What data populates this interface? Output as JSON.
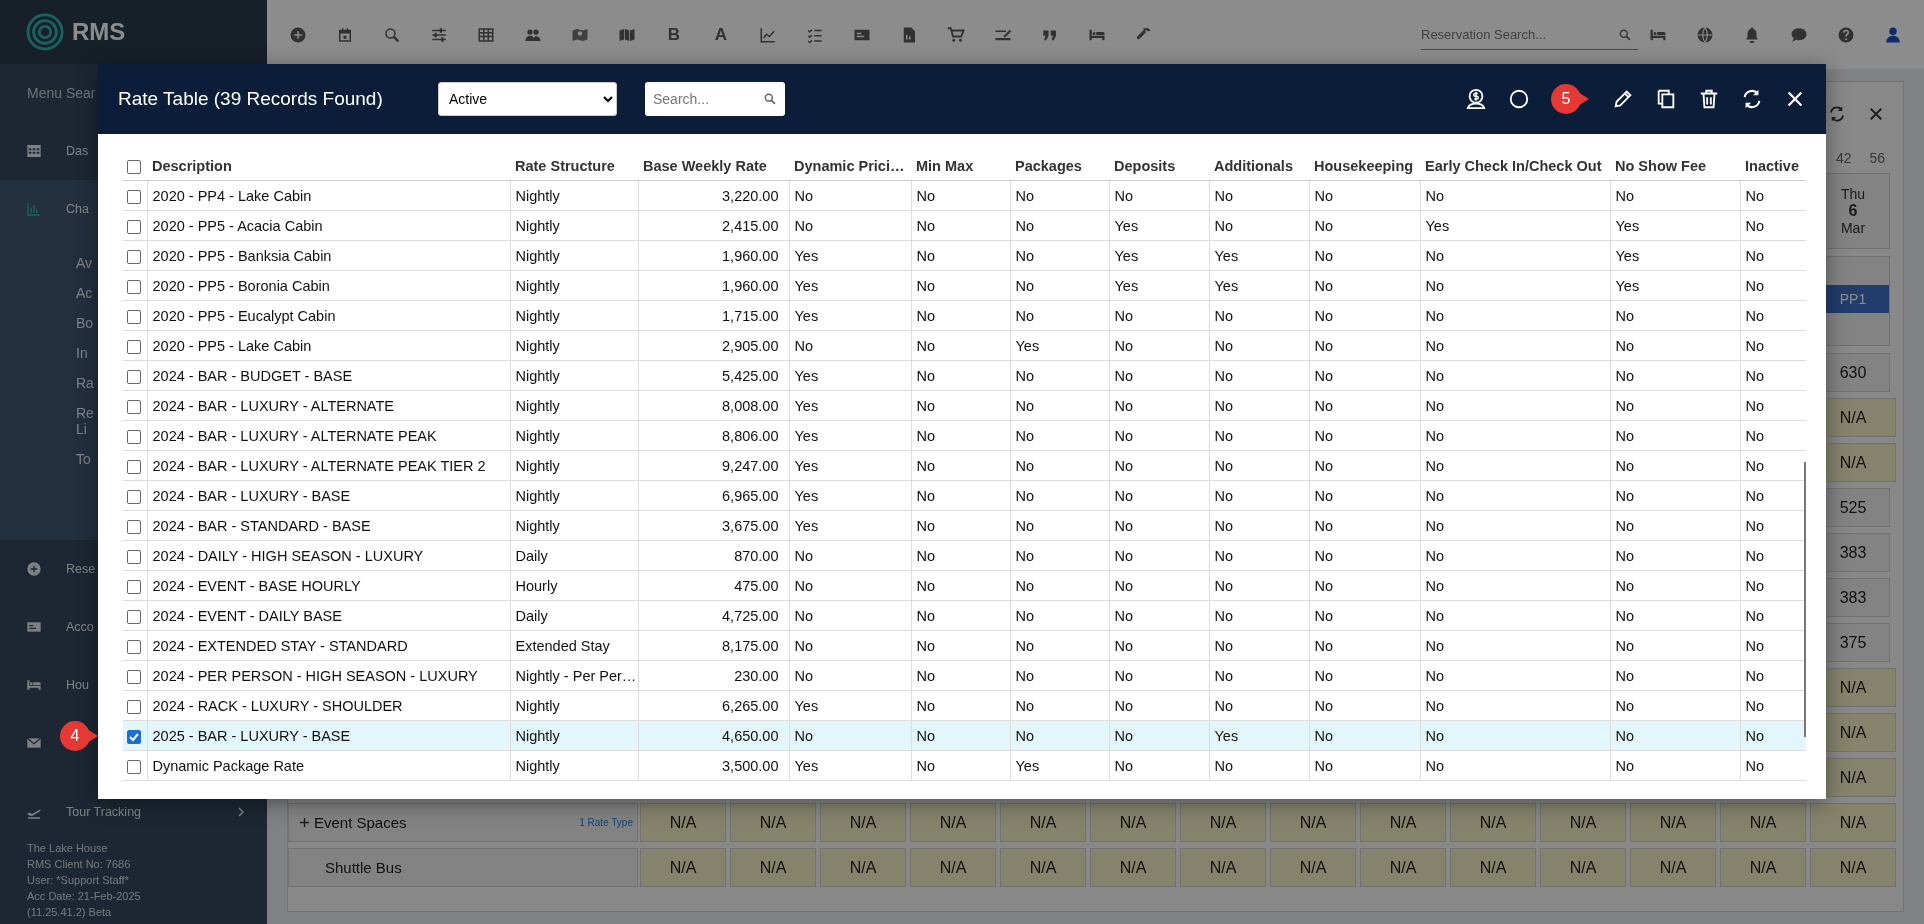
{
  "sidebar": {
    "brand": "RMS",
    "menu_search": "Menu Sear",
    "items": [
      {
        "label": "Das",
        "expanded": false,
        "has_submenu": false
      },
      {
        "label": "Cha",
        "expanded": true,
        "has_submenu": false,
        "children": [
          {
            "label": "Av"
          },
          {
            "label": "Ac"
          },
          {
            "label": "Bo"
          },
          {
            "label": "In"
          },
          {
            "label": "Ra"
          },
          {
            "label": "Re Li"
          },
          {
            "label": "To"
          }
        ]
      },
      {
        "label": "Rese",
        "expanded": false,
        "has_submenu": false
      },
      {
        "label": "Acco",
        "expanded": false,
        "has_submenu": false
      },
      {
        "label": "Hou",
        "expanded": false,
        "has_submenu": false
      },
      {
        "expanded": false,
        "has_submenu": false
      },
      {
        "label": "Tour Tracking",
        "expanded": false,
        "has_submenu": true
      }
    ],
    "footer": [
      "The Lake House",
      "RMS Client No: 7686",
      "User: *Support Staff*",
      "Acc Date: 21-Feb-2025",
      "(11.25.41.2) Beta"
    ]
  },
  "topbar": {
    "tools": [
      {
        "kind": "icon"
      },
      {
        "kind": "icon"
      },
      {
        "kind": "icon"
      },
      {
        "kind": "icon"
      },
      {
        "kind": "icon"
      },
      {
        "kind": "icon"
      },
      {
        "kind": "icon"
      },
      {
        "kind": "icon"
      },
      {
        "kind": "letter",
        "label": "B"
      },
      {
        "kind": "letter",
        "label": "A"
      },
      {
        "kind": "icon"
      },
      {
        "kind": "icon"
      },
      {
        "kind": "icon"
      },
      {
        "kind": "icon"
      },
      {
        "kind": "icon"
      },
      {
        "kind": "icon"
      },
      {
        "kind": "icon"
      },
      {
        "kind": "icon"
      },
      {
        "kind": "icon"
      }
    ],
    "reservation_search": {
      "placeholder": "Reservation Search..."
    }
  },
  "calendar": {
    "counts": [
      "42",
      "56"
    ],
    "day": {
      "weekday": "Thu",
      "day": "6",
      "month": "Mar"
    },
    "booking": "PP1",
    "column_cells": [
      {
        "text": "630",
        "kind": "rate"
      },
      {
        "text": "N/A",
        "kind": "na"
      },
      {
        "text": "N/A",
        "kind": "na"
      },
      {
        "text": "525",
        "kind": "rate"
      },
      {
        "text": "383",
        "kind": "rate"
      },
      {
        "text": "383",
        "kind": "rate"
      },
      {
        "text": "375",
        "kind": "rate"
      },
      {
        "text": "N/A",
        "kind": "na"
      },
      {
        "text": "N/A",
        "kind": "na"
      },
      {
        "text": "N/A",
        "kind": "na"
      }
    ],
    "rows": [
      {
        "label": "Event Spaces",
        "expandable": true,
        "note": "1 Rate Type",
        "cells": [
          "N/A",
          "N/A",
          "N/A",
          "N/A",
          "N/A",
          "N/A",
          "N/A",
          "N/A",
          "N/A",
          "N/A",
          "N/A",
          "N/A",
          "N/A",
          "N/A"
        ]
      },
      {
        "label": "Shuttle Bus",
        "expandable": false,
        "cells": [
          "N/A",
          "N/A",
          "N/A",
          "N/A",
          "N/A",
          "N/A",
          "N/A",
          "N/A",
          "N/A",
          "N/A",
          "N/A",
          "N/A",
          "N/A",
          "N/A"
        ]
      }
    ]
  },
  "modal": {
    "title": "Rate Table (39 Records Found)",
    "filter": {
      "value": "Active"
    },
    "search": {
      "placeholder": "Search..."
    },
    "callout": "5"
  },
  "table": {
    "select_all_checked": false,
    "columns": [
      {
        "label": "Description",
        "kind": "text"
      },
      {
        "label": "Rate Structure",
        "kind": "text"
      },
      {
        "label": "Base Weekly Rate",
        "kind": "number"
      },
      {
        "label": "Dynamic Prici…",
        "kind": "text"
      },
      {
        "label": "Min Max",
        "kind": "text"
      },
      {
        "label": "Packages",
        "kind": "text"
      },
      {
        "label": "Deposits",
        "kind": "text"
      },
      {
        "label": "Additionals",
        "kind": "text"
      },
      {
        "label": "Housekeeping",
        "kind": "text"
      },
      {
        "label": "Early Check In/Check Out",
        "kind": "text"
      },
      {
        "label": "No Show Fee",
        "kind": "text"
      },
      {
        "label": "Inactive",
        "kind": "text"
      }
    ],
    "rows": [
      {
        "selected": false,
        "cells": [
          "2020 - PP4 - Lake Cabin",
          "Nightly",
          "3,220.00",
          "No",
          "No",
          "No",
          "No",
          "No",
          "No",
          "No",
          "No",
          "No"
        ]
      },
      {
        "selected": false,
        "cells": [
          "2020 - PP5 - Acacia Cabin",
          "Nightly",
          "2,415.00",
          "No",
          "No",
          "No",
          "Yes",
          "No",
          "No",
          "Yes",
          "Yes",
          "No"
        ]
      },
      {
        "selected": false,
        "cells": [
          "2020 - PP5 - Banksia Cabin",
          "Nightly",
          "1,960.00",
          "Yes",
          "No",
          "No",
          "Yes",
          "Yes",
          "No",
          "No",
          "Yes",
          "No"
        ]
      },
      {
        "selected": false,
        "cells": [
          "2020 - PP5 - Boronia Cabin",
          "Nightly",
          "1,960.00",
          "Yes",
          "No",
          "No",
          "Yes",
          "Yes",
          "No",
          "No",
          "Yes",
          "No"
        ]
      },
      {
        "selected": false,
        "cells": [
          "2020 - PP5 - Eucalypt Cabin",
          "Nightly",
          "1,715.00",
          "Yes",
          "No",
          "No",
          "No",
          "No",
          "No",
          "No",
          "No",
          "No"
        ]
      },
      {
        "selected": false,
        "cells": [
          "2020 - PP5 - Lake Cabin",
          "Nightly",
          "2,905.00",
          "No",
          "No",
          "Yes",
          "No",
          "No",
          "No",
          "No",
          "No",
          "No"
        ]
      },
      {
        "selected": false,
        "cells": [
          "2024 - BAR - BUDGET - BASE",
          "Nightly",
          "5,425.00",
          "Yes",
          "No",
          "No",
          "No",
          "No",
          "No",
          "No",
          "No",
          "No"
        ]
      },
      {
        "selected": false,
        "cells": [
          "2024 - BAR - LUXURY - ALTERNATE",
          "Nightly",
          "8,008.00",
          "Yes",
          "No",
          "No",
          "No",
          "No",
          "No",
          "No",
          "No",
          "No"
        ]
      },
      {
        "selected": false,
        "cells": [
          "2024 - BAR - LUXURY - ALTERNATE PEAK",
          "Nightly",
          "8,806.00",
          "Yes",
          "No",
          "No",
          "No",
          "No",
          "No",
          "No",
          "No",
          "No"
        ]
      },
      {
        "selected": false,
        "cells": [
          "2024 - BAR - LUXURY - ALTERNATE PEAK TIER 2",
          "Nightly",
          "9,247.00",
          "Yes",
          "No",
          "No",
          "No",
          "No",
          "No",
          "No",
          "No",
          "No"
        ]
      },
      {
        "selected": false,
        "cells": [
          "2024 - BAR - LUXURY - BASE",
          "Nightly",
          "6,965.00",
          "Yes",
          "No",
          "No",
          "No",
          "No",
          "No",
          "No",
          "No",
          "No"
        ]
      },
      {
        "selected": false,
        "cells": [
          "2024 - BAR - STANDARD - BASE",
          "Nightly",
          "3,675.00",
          "Yes",
          "No",
          "No",
          "No",
          "No",
          "No",
          "No",
          "No",
          "No"
        ]
      },
      {
        "selected": false,
        "cells": [
          "2024 - DAILY - HIGH SEASON - LUXURY",
          "Daily",
          "870.00",
          "No",
          "No",
          "No",
          "No",
          "No",
          "No",
          "No",
          "No",
          "No"
        ]
      },
      {
        "selected": false,
        "cells": [
          "2024 - EVENT - BASE HOURLY",
          "Hourly",
          "475.00",
          "No",
          "No",
          "No",
          "No",
          "No",
          "No",
          "No",
          "No",
          "No"
        ]
      },
      {
        "selected": false,
        "cells": [
          "2024 - EVENT - DAILY BASE",
          "Daily",
          "4,725.00",
          "No",
          "No",
          "No",
          "No",
          "No",
          "No",
          "No",
          "No",
          "No"
        ]
      },
      {
        "selected": false,
        "cells": [
          "2024 - EXTENDED STAY - STANDARD",
          "Extended Stay",
          "8,175.00",
          "No",
          "No",
          "No",
          "No",
          "No",
          "No",
          "No",
          "No",
          "No"
        ]
      },
      {
        "selected": false,
        "cells": [
          "2024 - PER PERSON - HIGH SEASON - LUXURY",
          "Nightly - Per Per…",
          "230.00",
          "No",
          "No",
          "No",
          "No",
          "No",
          "No",
          "No",
          "No",
          "No"
        ]
      },
      {
        "selected": false,
        "cells": [
          "2024 - RACK - LUXURY - SHOULDER",
          "Nightly",
          "6,265.00",
          "Yes",
          "No",
          "No",
          "No",
          "No",
          "No",
          "No",
          "No",
          "No"
        ]
      },
      {
        "selected": true,
        "callout": "4",
        "cells": [
          "2025 - BAR - LUXURY - BASE",
          "Nightly",
          "4,650.00",
          "No",
          "No",
          "No",
          "No",
          "Yes",
          "No",
          "No",
          "No",
          "No"
        ]
      },
      {
        "selected": false,
        "cells": [
          "Dynamic Package Rate",
          "Nightly",
          "3,500.00",
          "Yes",
          "No",
          "Yes",
          "No",
          "No",
          "No",
          "No",
          "No",
          "No"
        ]
      }
    ]
  }
}
